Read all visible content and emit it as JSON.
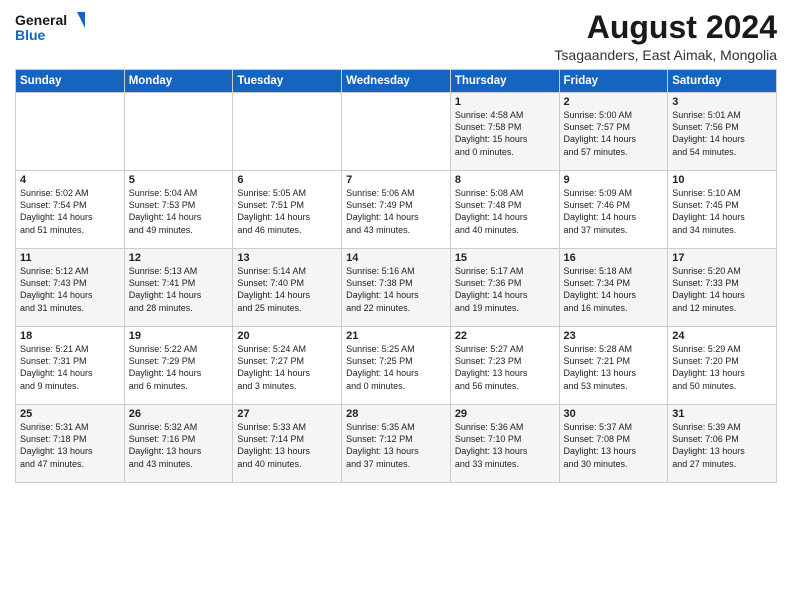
{
  "header": {
    "logo_line1": "General",
    "logo_line2": "Blue",
    "month_year": "August 2024",
    "location": "Tsagaanders, East Aimak, Mongolia"
  },
  "days_of_week": [
    "Sunday",
    "Monday",
    "Tuesday",
    "Wednesday",
    "Thursday",
    "Friday",
    "Saturday"
  ],
  "weeks": [
    [
      {
        "day": "",
        "info": ""
      },
      {
        "day": "",
        "info": ""
      },
      {
        "day": "",
        "info": ""
      },
      {
        "day": "",
        "info": ""
      },
      {
        "day": "1",
        "info": "Sunrise: 4:58 AM\nSunset: 7:58 PM\nDaylight: 15 hours\nand 0 minutes."
      },
      {
        "day": "2",
        "info": "Sunrise: 5:00 AM\nSunset: 7:57 PM\nDaylight: 14 hours\nand 57 minutes."
      },
      {
        "day": "3",
        "info": "Sunrise: 5:01 AM\nSunset: 7:56 PM\nDaylight: 14 hours\nand 54 minutes."
      }
    ],
    [
      {
        "day": "4",
        "info": "Sunrise: 5:02 AM\nSunset: 7:54 PM\nDaylight: 14 hours\nand 51 minutes."
      },
      {
        "day": "5",
        "info": "Sunrise: 5:04 AM\nSunset: 7:53 PM\nDaylight: 14 hours\nand 49 minutes."
      },
      {
        "day": "6",
        "info": "Sunrise: 5:05 AM\nSunset: 7:51 PM\nDaylight: 14 hours\nand 46 minutes."
      },
      {
        "day": "7",
        "info": "Sunrise: 5:06 AM\nSunset: 7:49 PM\nDaylight: 14 hours\nand 43 minutes."
      },
      {
        "day": "8",
        "info": "Sunrise: 5:08 AM\nSunset: 7:48 PM\nDaylight: 14 hours\nand 40 minutes."
      },
      {
        "day": "9",
        "info": "Sunrise: 5:09 AM\nSunset: 7:46 PM\nDaylight: 14 hours\nand 37 minutes."
      },
      {
        "day": "10",
        "info": "Sunrise: 5:10 AM\nSunset: 7:45 PM\nDaylight: 14 hours\nand 34 minutes."
      }
    ],
    [
      {
        "day": "11",
        "info": "Sunrise: 5:12 AM\nSunset: 7:43 PM\nDaylight: 14 hours\nand 31 minutes."
      },
      {
        "day": "12",
        "info": "Sunrise: 5:13 AM\nSunset: 7:41 PM\nDaylight: 14 hours\nand 28 minutes."
      },
      {
        "day": "13",
        "info": "Sunrise: 5:14 AM\nSunset: 7:40 PM\nDaylight: 14 hours\nand 25 minutes."
      },
      {
        "day": "14",
        "info": "Sunrise: 5:16 AM\nSunset: 7:38 PM\nDaylight: 14 hours\nand 22 minutes."
      },
      {
        "day": "15",
        "info": "Sunrise: 5:17 AM\nSunset: 7:36 PM\nDaylight: 14 hours\nand 19 minutes."
      },
      {
        "day": "16",
        "info": "Sunrise: 5:18 AM\nSunset: 7:34 PM\nDaylight: 14 hours\nand 16 minutes."
      },
      {
        "day": "17",
        "info": "Sunrise: 5:20 AM\nSunset: 7:33 PM\nDaylight: 14 hours\nand 12 minutes."
      }
    ],
    [
      {
        "day": "18",
        "info": "Sunrise: 5:21 AM\nSunset: 7:31 PM\nDaylight: 14 hours\nand 9 minutes."
      },
      {
        "day": "19",
        "info": "Sunrise: 5:22 AM\nSunset: 7:29 PM\nDaylight: 14 hours\nand 6 minutes."
      },
      {
        "day": "20",
        "info": "Sunrise: 5:24 AM\nSunset: 7:27 PM\nDaylight: 14 hours\nand 3 minutes."
      },
      {
        "day": "21",
        "info": "Sunrise: 5:25 AM\nSunset: 7:25 PM\nDaylight: 14 hours\nand 0 minutes."
      },
      {
        "day": "22",
        "info": "Sunrise: 5:27 AM\nSunset: 7:23 PM\nDaylight: 13 hours\nand 56 minutes."
      },
      {
        "day": "23",
        "info": "Sunrise: 5:28 AM\nSunset: 7:21 PM\nDaylight: 13 hours\nand 53 minutes."
      },
      {
        "day": "24",
        "info": "Sunrise: 5:29 AM\nSunset: 7:20 PM\nDaylight: 13 hours\nand 50 minutes."
      }
    ],
    [
      {
        "day": "25",
        "info": "Sunrise: 5:31 AM\nSunset: 7:18 PM\nDaylight: 13 hours\nand 47 minutes."
      },
      {
        "day": "26",
        "info": "Sunrise: 5:32 AM\nSunset: 7:16 PM\nDaylight: 13 hours\nand 43 minutes."
      },
      {
        "day": "27",
        "info": "Sunrise: 5:33 AM\nSunset: 7:14 PM\nDaylight: 13 hours\nand 40 minutes."
      },
      {
        "day": "28",
        "info": "Sunrise: 5:35 AM\nSunset: 7:12 PM\nDaylight: 13 hours\nand 37 minutes."
      },
      {
        "day": "29",
        "info": "Sunrise: 5:36 AM\nSunset: 7:10 PM\nDaylight: 13 hours\nand 33 minutes."
      },
      {
        "day": "30",
        "info": "Sunrise: 5:37 AM\nSunset: 7:08 PM\nDaylight: 13 hours\nand 30 minutes."
      },
      {
        "day": "31",
        "info": "Sunrise: 5:39 AM\nSunset: 7:06 PM\nDaylight: 13 hours\nand 27 minutes."
      }
    ]
  ]
}
